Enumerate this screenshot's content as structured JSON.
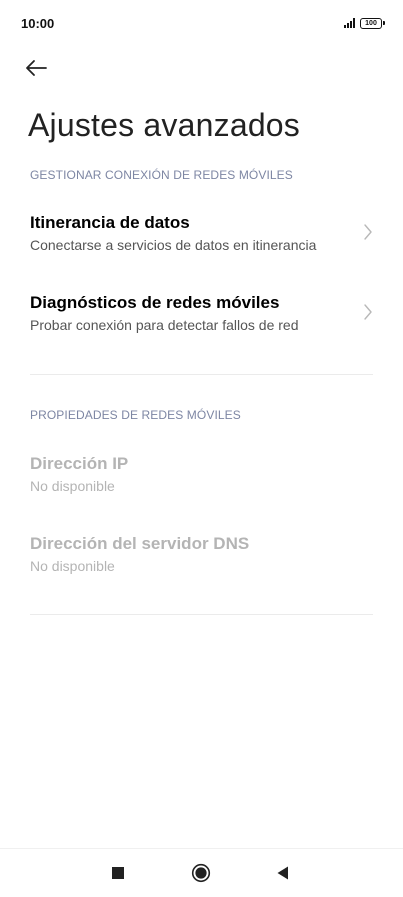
{
  "status_bar": {
    "time": "10:00",
    "battery": "100"
  },
  "header": {
    "title": "Ajustes avanzados"
  },
  "sections": [
    {
      "header": "GESTIONAR CONEXIÓN DE REDES MÓVILES",
      "items": [
        {
          "title": "Itinerancia de datos",
          "subtitle": "Conectarse a servicios de datos en itinerancia",
          "enabled": true
        },
        {
          "title": "Diagnósticos de redes móviles",
          "subtitle": "Probar conexión para detectar fallos de red",
          "enabled": true
        }
      ]
    },
    {
      "header": "PROPIEDADES DE REDES MÓVILES",
      "items": [
        {
          "title": "Dirección IP",
          "subtitle": "No disponible",
          "enabled": false
        },
        {
          "title": "Dirección del servidor DNS",
          "subtitle": "No disponible",
          "enabled": false
        }
      ]
    }
  ],
  "colors": {
    "section_header": "#7d86a3",
    "disabled_text": "#b4b4b4",
    "divider": "#ebebeb"
  },
  "icons": {
    "back": "arrow-left-icon",
    "chevron": "chevron-right-icon",
    "nav_recents": "square-icon",
    "nav_home": "circle-icon",
    "nav_back": "triangle-left-icon"
  }
}
